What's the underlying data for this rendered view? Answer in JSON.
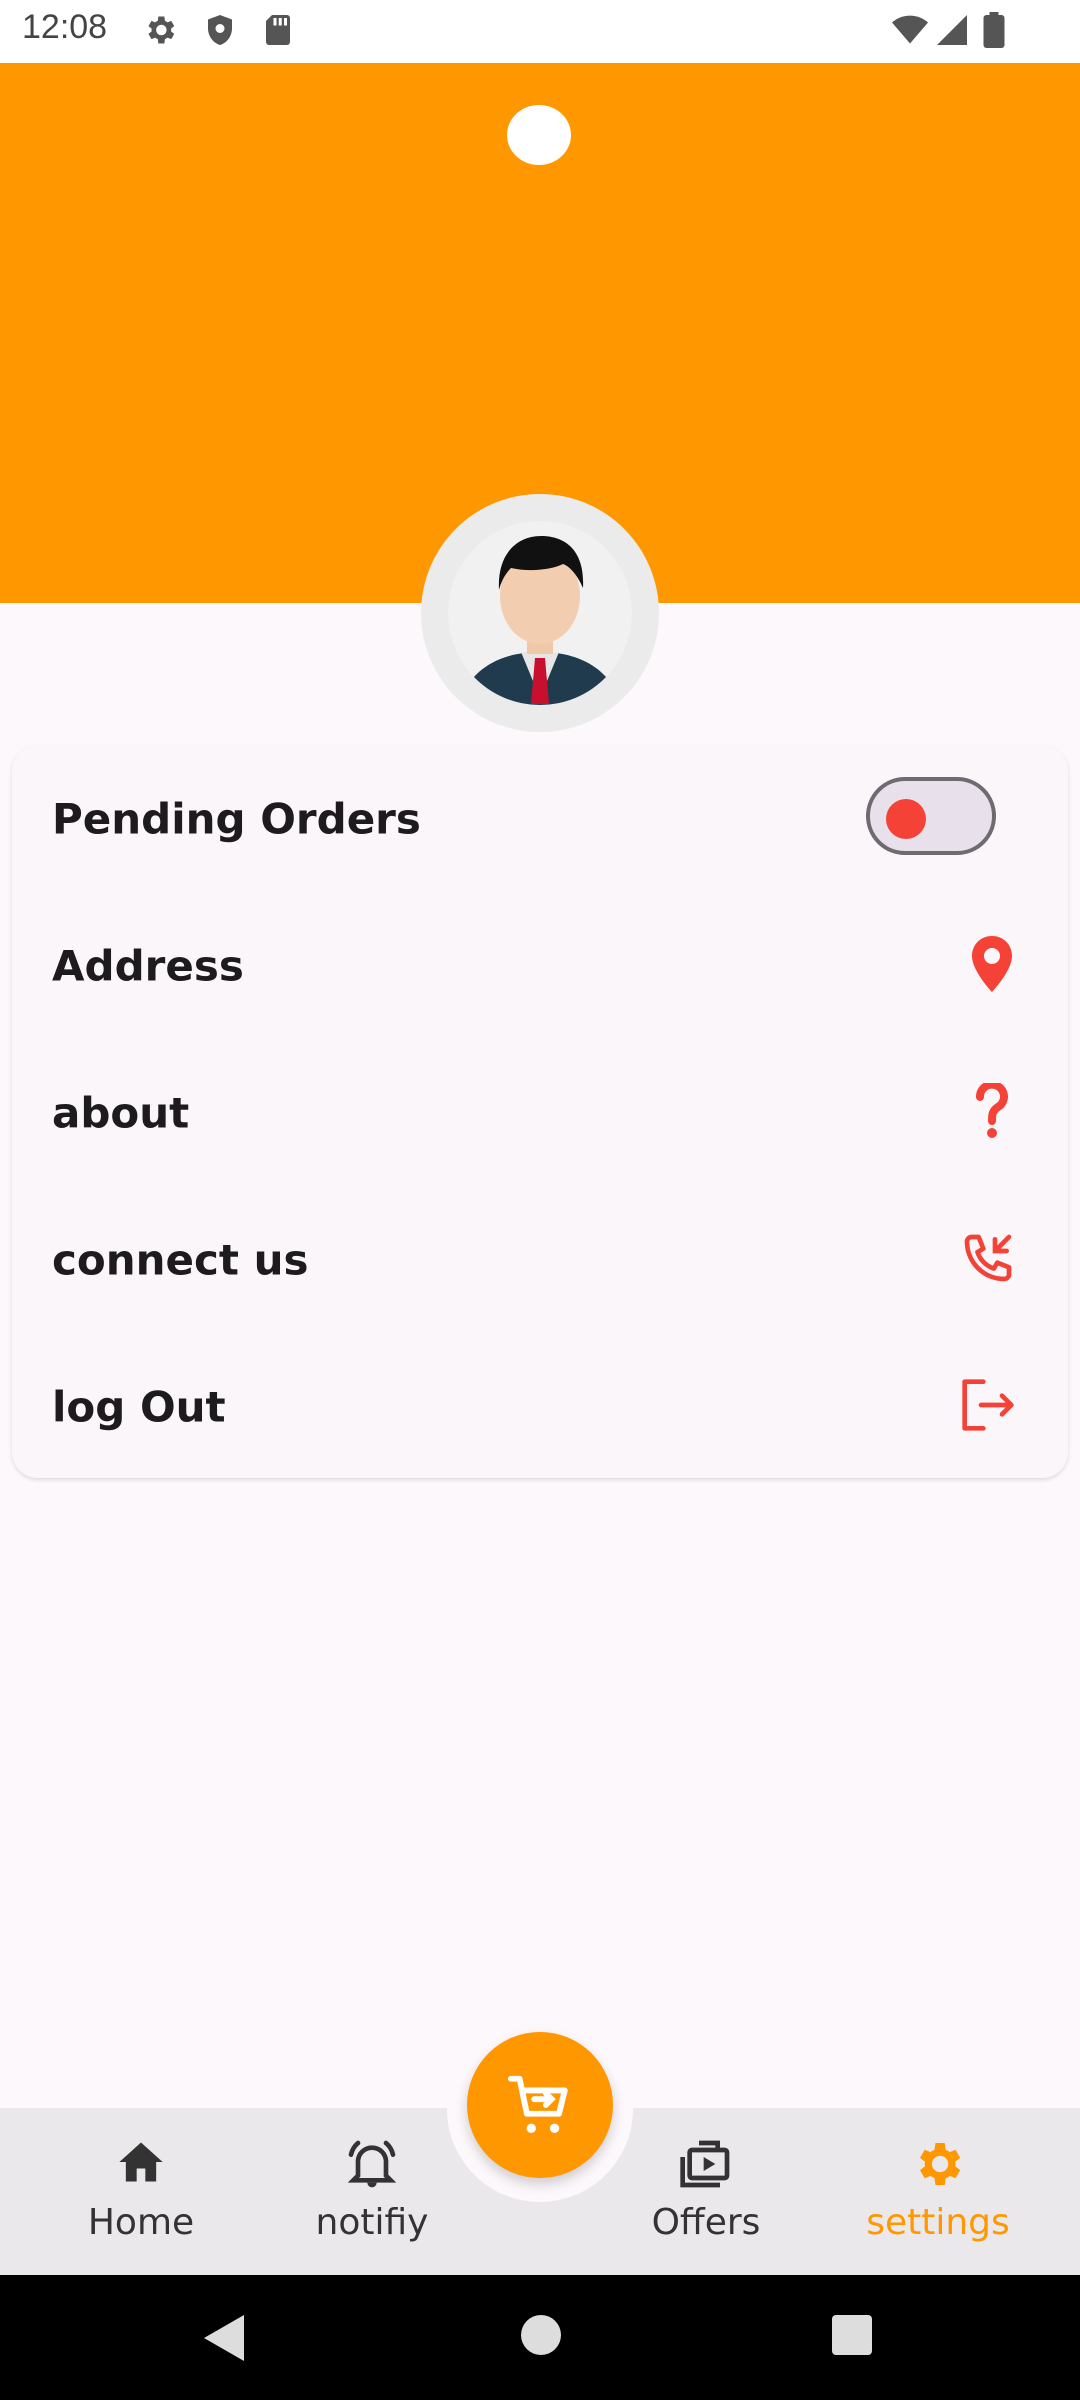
{
  "status_bar": {
    "time": "12:08",
    "left_icons": [
      "gear-icon",
      "shield-icon",
      "sd-card-icon"
    ],
    "right_icons": [
      "wifi-icon",
      "signal-icon",
      "battery-icon"
    ]
  },
  "colors": {
    "accent": "#ff9800",
    "icon_red": "#f44336",
    "background": "#fdf8fb",
    "nav_background": "#ebe8eb"
  },
  "settings": {
    "items": [
      {
        "label": "Pending Orders",
        "control": "toggle",
        "toggle_on": false
      },
      {
        "label": "Address",
        "icon": "location-pin-icon"
      },
      {
        "label": "about",
        "icon": "question-mark-icon"
      },
      {
        "label": "connect us",
        "icon": "phone-callback-icon"
      },
      {
        "label": "log Out",
        "icon": "logout-icon"
      }
    ]
  },
  "bottom_nav": {
    "items": [
      {
        "label": "Home",
        "icon": "home-icon",
        "active": false
      },
      {
        "label": "notifiy",
        "icon": "bell-icon",
        "active": false
      },
      {
        "label": "Offers",
        "icon": "offers-icon",
        "active": false
      },
      {
        "label": "settings",
        "icon": "gear-icon",
        "active": true
      }
    ],
    "fab_icon": "cart-icon"
  },
  "system_nav": [
    "back-icon",
    "home-circle-icon",
    "recents-icon"
  ]
}
